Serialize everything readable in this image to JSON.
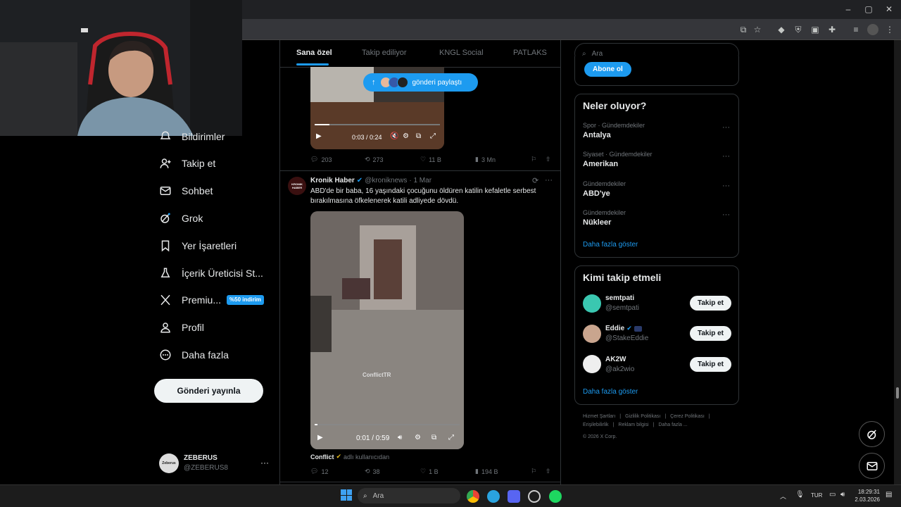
{
  "browser": {
    "controls": {
      "minimize": "–",
      "maximize": "▢",
      "close": "✕"
    }
  },
  "sidebar": {
    "items": [
      {
        "label": "Bildirimler",
        "icon": "bell-icon"
      },
      {
        "label": "Takip et",
        "icon": "person-add-icon"
      },
      {
        "label": "Sohbet",
        "icon": "mail-icon"
      },
      {
        "label": "Grok",
        "icon": "grok-icon"
      },
      {
        "label": "Yer İşaretleri",
        "icon": "bookmark-icon"
      },
      {
        "label": "İçerik Üreticisi St...",
        "icon": "creator-studio-icon"
      },
      {
        "label": "Premiu...",
        "icon": "x-logo-icon",
        "badge": "%50 indirim"
      },
      {
        "label": "Profil",
        "icon": "person-icon"
      },
      {
        "label": "Daha fazla",
        "icon": "more-circle-icon"
      }
    ],
    "post_button": "Gönderi yayınla",
    "account": {
      "name": "ZEBERUS",
      "handle": "@ZEBERUS8",
      "avatar_text": "Zeberus"
    }
  },
  "main": {
    "tabs": [
      "Sana özel",
      "Takip ediliyor",
      "KNGL Social",
      "PATLAKS"
    ],
    "active_tab": "Sana özel",
    "new_posts_pill": "gönderi paylaştı",
    "tweet1": {
      "video_time": "0:03 / 0:24",
      "progress": 0.12,
      "stats": {
        "replies": "203",
        "retweets": "273",
        "likes": "11 B",
        "views": "3 Mn"
      }
    },
    "tweet2": {
      "author": "Kronik Haber",
      "avatar_text": "KRONIK HABER",
      "handle": "@kroniknews",
      "date": "· 1 Mar",
      "text": "ABD'de bir baba, 16 yaşındaki çocuğunu öldüren katilin kefaletle serbest bırakılmasına öfkelenerek katili adliyede dövdü.",
      "video_time": "0:01 / 0:59",
      "progress": 0.02,
      "watermark": "ConflictTR",
      "source_name": "Conflict",
      "source_suffix": "adlı kullanıcıdan",
      "stats": {
        "replies": "12",
        "retweets": "38",
        "likes": "1 B",
        "views": "194 B"
      }
    }
  },
  "right": {
    "search_placeholder": "Ara",
    "subscribe_button": "Abone ol",
    "trends": {
      "title": "Neler oluyor?",
      "items": [
        {
          "category": "Spor · Gündemdekiler",
          "title": "Antalya"
        },
        {
          "category": "Siyaset · Gündemdekiler",
          "title": "Amerikan"
        },
        {
          "category": "Gündemdekiler",
          "title": "ABD'ye"
        },
        {
          "category": "Gündemdekiler",
          "title": "Nükleer"
        }
      ],
      "show_more": "Daha fazla göster"
    },
    "who_to_follow": {
      "title": "Kimi takip etmeli",
      "users": [
        {
          "name": "semtpati",
          "handle": "@semtpati",
          "button": "Takip et"
        },
        {
          "name": "Eddie",
          "handle": "@StakeEddie",
          "button": "Takip et"
        },
        {
          "name": "AK2W",
          "handle": "@ak2wio",
          "button": "Takip et"
        }
      ],
      "show_more": "Daha fazla göster"
    },
    "footer": {
      "links": [
        "Hizmet Şartları",
        "Gizlilik Politikası",
        "Çerez Politikası",
        "Erişilebilirlik",
        "Reklam bilgisi",
        "Daha fazla ..."
      ],
      "copyright": "© 2026 X Corp."
    }
  },
  "taskbar": {
    "search_placeholder": "Ara",
    "language": "TUR",
    "time": "18:29:31",
    "date": "2.03.2026"
  },
  "colors": {
    "accent": "#1d9bf0",
    "background": "#000000",
    "premium_badge": "#1d9bf0"
  }
}
